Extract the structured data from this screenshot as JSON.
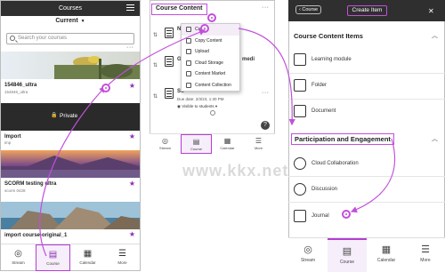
{
  "panel1": {
    "header": {
      "title": "Courses"
    },
    "filter": {
      "label": "Current",
      "chevron": "▼"
    },
    "search": {
      "placeholder": "Search your courses"
    },
    "courses": [
      {
        "title": "154846_ultra",
        "subtitle": "154846_ultra",
        "image": "cactus-sunset"
      },
      {
        "title": "Import",
        "subtitle": "imp",
        "image": "dark-banner",
        "badge": "Private"
      },
      {
        "title": "SCORM testing ultra",
        "subtitle": "scorm 0428",
        "image": "purple-mountain-lake"
      },
      {
        "title": "import course-original_1",
        "subtitle": "",
        "image": "rocky-coast"
      }
    ],
    "nav": [
      {
        "label": "Stream",
        "icon": "globe-icon"
      },
      {
        "label": "Course",
        "icon": "course-book-icon",
        "active": true
      },
      {
        "label": "Calendar",
        "icon": "calendar-icon"
      },
      {
        "label": "More",
        "icon": "more-menu-icon"
      }
    ]
  },
  "panel2": {
    "title": "Course Content",
    "menu": [
      {
        "label": "Create",
        "icon": "create-icon",
        "selected": true
      },
      {
        "label": "Copy Content",
        "icon": "copy-icon"
      },
      {
        "label": "Upload",
        "icon": "upload-icon"
      },
      {
        "label": "Cloud Storage",
        "icon": "cloud-icon"
      },
      {
        "label": "Content Market",
        "icon": "market-icon"
      },
      {
        "label": "Content Collection",
        "icon": "collection-icon"
      }
    ],
    "rows": [
      {
        "label": "Ne"
      },
      {
        "label": "Go",
        "suffix": "medi"
      },
      {
        "label": "Su",
        "due": "Due date: 2/3/23, 1:30 PM",
        "visibility": "Visible to students"
      }
    ],
    "nav": [
      {
        "label": "Stream",
        "icon": "globe-icon"
      },
      {
        "label": "Course",
        "icon": "course-book-icon",
        "active": true
      },
      {
        "label": "Calendar",
        "icon": "calendar-icon"
      },
      {
        "label": "More",
        "icon": "more-menu-icon"
      }
    ]
  },
  "panel3": {
    "header": {
      "back_label": "Course",
      "create_label": "Create Item"
    },
    "sections": [
      {
        "title": "Course Content Items",
        "items": [
          {
            "label": "Learning module",
            "icon": "learning-module-icon"
          },
          {
            "label": "Folder",
            "icon": "folder-icon"
          },
          {
            "label": "Document",
            "icon": "document-icon"
          }
        ]
      },
      {
        "title": "Participation and Engagement",
        "items": [
          {
            "label": "Cloud Collaboration",
            "icon": "cloud-collaboration-icon"
          },
          {
            "label": "Discussion",
            "icon": "discussion-icon"
          },
          {
            "label": "Journal",
            "icon": "journal-icon"
          }
        ]
      }
    ],
    "nav": [
      {
        "label": "Stream",
        "icon": "globe-icon"
      },
      {
        "label": "Course",
        "icon": "course-book-icon",
        "active": true
      },
      {
        "label": "Calendar",
        "icon": "calendar-icon"
      },
      {
        "label": "More",
        "icon": "more-menu-icon"
      }
    ]
  },
  "watermark": "www.kkx.net",
  "colors": {
    "accent": "#c24fdc",
    "header_bg": "#2f2f2f",
    "star": "#8b2fb0"
  }
}
